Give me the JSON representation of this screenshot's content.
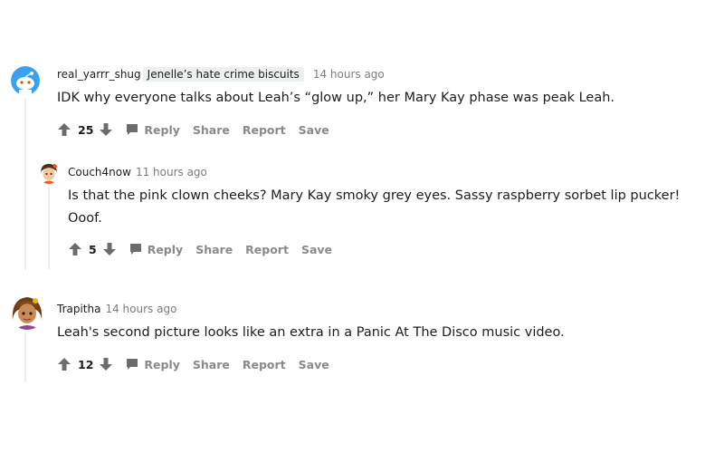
{
  "comments": [
    {
      "username": "real_yarrr_shug",
      "flair": "Jenelle’s hate crime biscuits",
      "time": "14 hours ago",
      "body": "IDK why everyone talks about Leah’s “glow up,” her Mary Kay phase was peak Leah.",
      "score": "25",
      "actions": {
        "reply": "Reply",
        "share": "Share",
        "report": "Report",
        "save": "Save"
      }
    },
    {
      "username": "Couch4now",
      "time": "11 hours ago",
      "body": "Is that the pink clown cheeks? Mary Kay smoky grey eyes. Sassy raspberry sorbet lip pucker! Ooof.",
      "score": "5",
      "actions": {
        "reply": "Reply",
        "share": "Share",
        "report": "Report",
        "save": "Save"
      }
    },
    {
      "username": "Trapitha",
      "time": "14 hours ago",
      "body": "Leah's second picture looks like an extra in a Panic At The Disco music video.",
      "score": "12",
      "actions": {
        "reply": "Reply",
        "share": "Share",
        "report": "Report",
        "save": "Save"
      }
    }
  ],
  "colors": {
    "text": "#1c1c1c",
    "muted": "#7c7c7c",
    "action": "#878a8c",
    "flair_bg": "#edeff1",
    "thread_line": "#edeff1"
  },
  "icons": [
    "snoo-avatar-icon",
    "upvote-icon",
    "downvote-icon",
    "comment-bubble-icon"
  ]
}
